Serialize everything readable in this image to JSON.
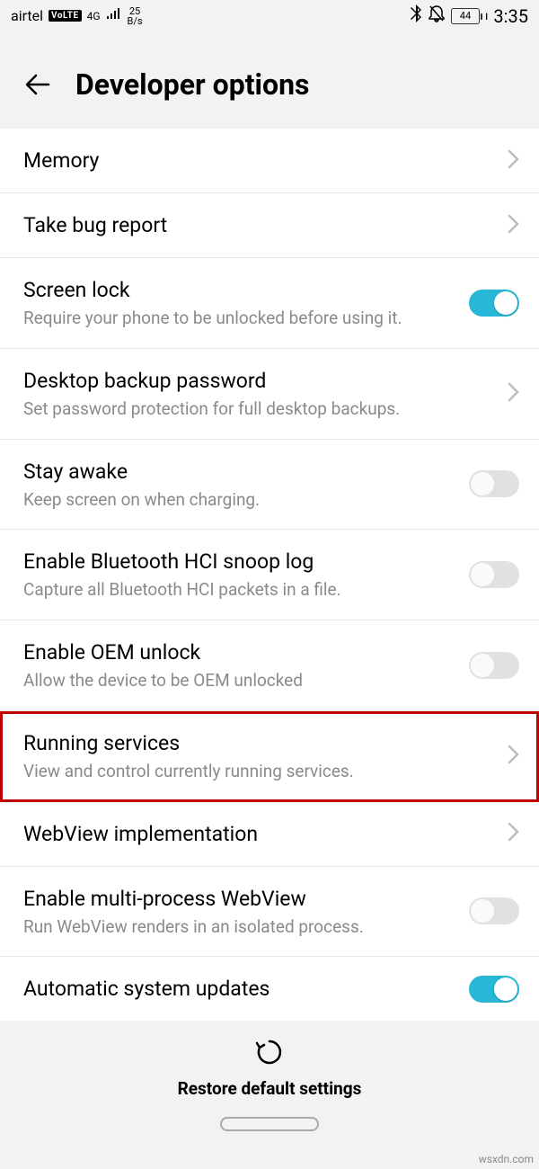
{
  "status": {
    "carrier": "airtel",
    "volte": "VoLTE",
    "net": "4G",
    "speed_top": "25",
    "speed_bot": "B/s",
    "battery": "44",
    "time": "3:35"
  },
  "header": {
    "title": "Developer options"
  },
  "rows": {
    "memory": {
      "title": "Memory"
    },
    "bugreport": {
      "title": "Take bug report"
    },
    "screenlock": {
      "title": "Screen lock",
      "sub": "Require your phone to be unlocked before using it."
    },
    "desktopbackup": {
      "title": "Desktop backup password",
      "sub": "Set password protection for full desktop backups."
    },
    "stayawake": {
      "title": "Stay awake",
      "sub": "Keep screen on when charging."
    },
    "hci": {
      "title": "Enable Bluetooth HCI snoop log",
      "sub": "Capture all Bluetooth HCI packets in a file."
    },
    "oem": {
      "title": "Enable OEM unlock",
      "sub": "Allow the device to be OEM unlocked"
    },
    "running": {
      "title": "Running services",
      "sub": "View and control currently running services."
    },
    "webview": {
      "title": "WebView implementation"
    },
    "multiwebview": {
      "title": "Enable multi-process WebView",
      "sub": "Run WebView renders in an isolated process."
    },
    "autoupdate": {
      "title": "Automatic system updates"
    }
  },
  "footer": {
    "restore": "Restore default settings"
  },
  "watermark": "wsxdn.com"
}
